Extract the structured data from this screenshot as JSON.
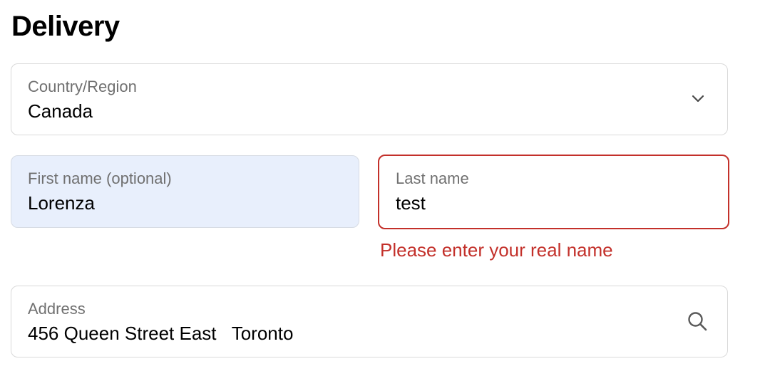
{
  "header": {
    "title": "Delivery"
  },
  "country": {
    "label": "Country/Region",
    "value": "Canada",
    "icon": "chevron-down-icon"
  },
  "first_name": {
    "label": "First name (optional)",
    "value": "Lorenza",
    "state": "autofilled",
    "background": "#e8effc"
  },
  "last_name": {
    "label": "Last name",
    "value": "test",
    "state": "error",
    "error": "Please enter your real name",
    "error_color": "#c3302a"
  },
  "address": {
    "label": "Address",
    "value": "456 Queen Street East   Toronto",
    "icon": "search-icon"
  }
}
